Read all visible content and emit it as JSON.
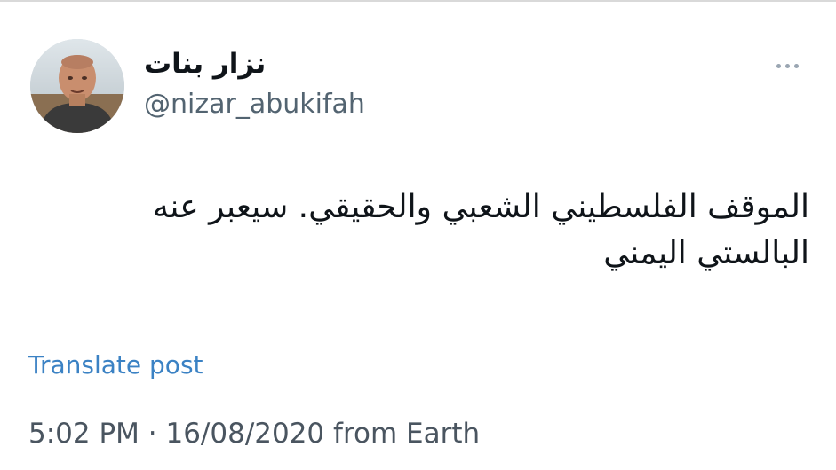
{
  "author": {
    "display_name": "نزار بنات",
    "handle": "@nizar_abukifah"
  },
  "tweet": {
    "text": "الموقف الفلسطيني الشعبي والحقيقي. سيعبر عنه البالستي اليمني"
  },
  "actions": {
    "translate_label": "Translate post",
    "more_icon": "more-horizontal-icon"
  },
  "meta": {
    "time": "5:02 PM",
    "separator": " · ",
    "date": "16/08/2020",
    "source": " from Earth"
  },
  "colors": {
    "link": "#3b82c4",
    "secondary_text": "#536471",
    "primary_text": "#0f1419"
  }
}
